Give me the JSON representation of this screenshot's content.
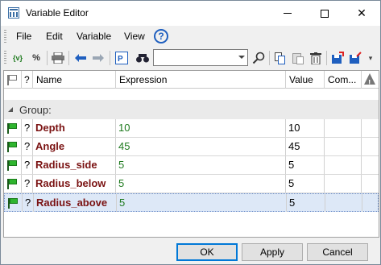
{
  "window": {
    "title": "Variable Editor"
  },
  "menu": {
    "items": [
      "File",
      "Edit",
      "Variable",
      "View"
    ],
    "help": "?"
  },
  "toolbar": {
    "icons": [
      "add-variable-icon",
      "add-function-icon",
      "print-icon",
      "undo-icon",
      "redo-icon",
      "equation-mode-icon",
      "find-icon",
      "search-icon",
      "copy-icon",
      "paste-icon",
      "delete-icon",
      "save-to-file-icon",
      "load-from-file-icon"
    ],
    "combo_value": "",
    "edit_glyph": "{v}"
  },
  "grid": {
    "columns": {
      "flag": "",
      "q": "?",
      "name": "Name",
      "expression": "Expression",
      "value": "Value",
      "comment": "Com...",
      "warning": ""
    },
    "group_label": "Group:",
    "rows": [
      {
        "q": "?",
        "name": "Depth",
        "expression": "10",
        "value": "10",
        "comment": ""
      },
      {
        "q": "?",
        "name": "Angle",
        "expression": "45",
        "value": "45",
        "comment": ""
      },
      {
        "q": "?",
        "name": "Radius_side",
        "expression": "5",
        "value": "5",
        "comment": ""
      },
      {
        "q": "?",
        "name": "Radius_below",
        "expression": "5",
        "value": "5",
        "comment": ""
      },
      {
        "q": "?",
        "name": "Radius_above",
        "expression": "5",
        "value": "5",
        "comment": ""
      }
    ],
    "selected_row": 4
  },
  "buttons": {
    "ok": "OK",
    "apply": "Apply",
    "cancel": "Cancel"
  },
  "colors": {
    "accent": "#0078d7",
    "name_text": "#7a1212",
    "expression_text": "#1e7a1e",
    "flag_green": "#2fb52f",
    "selection": "#dde8f7"
  }
}
